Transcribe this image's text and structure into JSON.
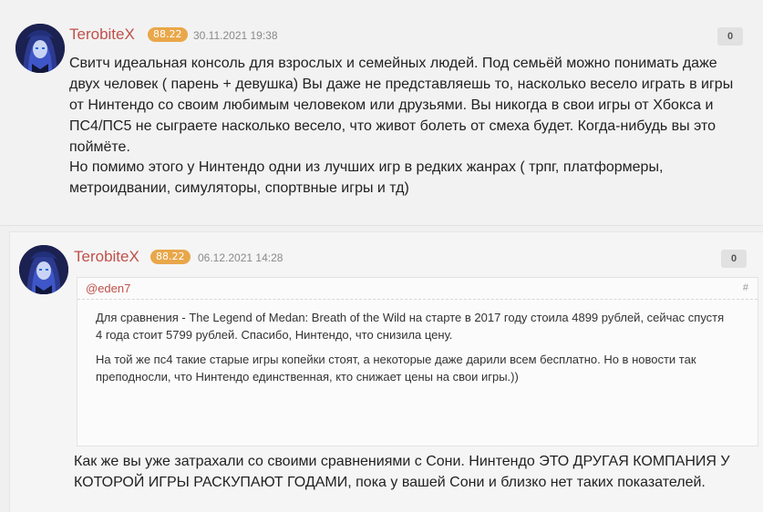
{
  "comments": [
    {
      "author": "TerobiteX",
      "rating": "88.22",
      "date": "30.11.2021 19:38",
      "votes": "0",
      "paragraphs": [
        "Свитч идеальная консоль для взрослых и семейных людей. Под семьёй можно понимать даже двух человек ( парень + девушка) Вы даже не представляешь то, насколько весело играть в игры от Нинтендо со своим любимым человеком или друзьями. Вы никогда в свои игры от Хбокса и ПС4/ПС5 не сыграете насколько весело, что живот болеть от смеха будет. Когда-нибудь вы это поймёте.",
        "Но помимо этого у Нинтендо одни из лучших игр в редких жанрах ( трпг, платформеры, метроидвании, симуляторы, спортвные игры и тд)"
      ]
    },
    {
      "author": "TerobiteX",
      "rating": "88.22",
      "date": "06.12.2021 14:28",
      "votes": "0",
      "quote": {
        "user": "@eden7",
        "hash": "#",
        "paragraphs": [
          "Для сравнения - The Legend of Medan: Breath of the Wild на старте в 2017 году стоила 4899 рублей, сейчас спустя 4 года стоит 5799 рублей. Спасибо, Нинтендо, что снизила цену.",
          "На той же пс4 такие старые игры копейки стоят, а некоторые даже дарили всем бесплатно. Но в новости так преподносли, что Нинтендо единственная, кто снижает цены на свои игры.))"
        ]
      },
      "paragraphs": [
        "Как же вы уже затрахали со своими сравнениями с Сони. Нинтендо ЭТО ДРУГАЯ КОМПАНИЯ У КОТОРОЙ ИГРЫ РАСКУПАЮТ ГОДАМИ, пока у вашей Сони и близко нет таких показателей."
      ]
    }
  ],
  "colors": {
    "author": "#c0504a",
    "rating_bg": "#e9a74a"
  },
  "icons": {
    "avatar": "anime-avatar-image"
  }
}
